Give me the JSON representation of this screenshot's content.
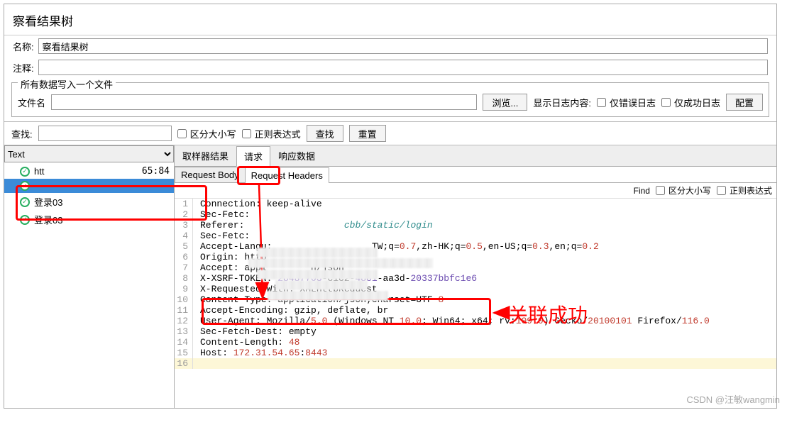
{
  "title": "察看结果树",
  "labels": {
    "name": "名称:",
    "comment": "注释:",
    "writeAll": "所有数据写入一个文件",
    "filename": "文件名",
    "browse": "浏览...",
    "showLog": "显示日志内容:",
    "errorOnly": "仅错误日志",
    "successOnly": "仅成功日志",
    "configure": "配置",
    "search": "查找:",
    "caseSensitive": "区分大小写",
    "regex": "正则表达式",
    "searchBtn": "查找",
    "reset": "重置",
    "findShort": "Find"
  },
  "values": {
    "name": "察看结果树",
    "renderer": "Text"
  },
  "tree": [
    {
      "label": "htt",
      "extra": "65:84"
    },
    {
      "label": "",
      "selected": true
    },
    {
      "label": "登录03"
    },
    {
      "label": "登录03"
    }
  ],
  "tabs": {
    "main": [
      "取样器结果",
      "请求",
      "响应数据"
    ],
    "mainActive": 1,
    "sub": [
      "Request Body",
      "Request Headers"
    ],
    "subActive": 1
  },
  "headers": [
    {
      "n": 1,
      "k": "Connection",
      "v": "keep-alive"
    },
    {
      "n": 2,
      "k": "Sec-Fetc",
      "v": ""
    },
    {
      "n": 3,
      "k": "Referer",
      "v": "",
      "trail": "cbb/static/login",
      "trailClass": "tok-url"
    },
    {
      "n": 4,
      "k": "Sec-Fetc",
      "v": ""
    },
    {
      "n": 5,
      "k": "Accept-Langu",
      "v": "",
      "trail": "TW;q=0.7,zh-HK;q=0.5,en-US;q=0.3,en;q=0.2"
    },
    {
      "n": 6,
      "k": "Origin",
      "v": "http"
    },
    {
      "n": 7,
      "k": "Accept",
      "v": "appl        n/json"
    },
    {
      "n": 8,
      "raw": "X-XSRF-TOKEN: <span class='tok-purple'>28487703</span>-c1c2-<span class='tok-purple'>4881</span>-aa3d-<span class='tok-purple'>20337bbfc1e6</span>"
    },
    {
      "n": 9,
      "k": "X-Requested-With",
      "v": "XMLHttpRequest"
    },
    {
      "n": 10,
      "raw": "Content-Type: application/json;charset=UTF-<span class='tok-num'>8</span>"
    },
    {
      "n": 11,
      "k": "Accept-Encoding",
      "v": "gzip, deflate, br"
    },
    {
      "n": 12,
      "raw": "User-Agent: Mozilla/<span class='tok-num'>5.0</span> (Windows NT <span class='tok-num'>10.0</span>; Win64; x64; rv:<span class='tok-num'>109.0</span>) Gecko/<span class='tok-num'>20100101</span> Firefox/<span class='tok-num'>116.0</span>"
    },
    {
      "n": 13,
      "k": "Sec-Fetch-Dest",
      "v": "empty"
    },
    {
      "n": 14,
      "raw": "Content-Length: <span class='tok-num'>48</span>"
    },
    {
      "n": 15,
      "raw": "Host: <span class='tok-num'>172.31.54.65</span>:<span class='tok-num'>8443</span>"
    },
    {
      "n": 16,
      "raw": "",
      "hl": true
    }
  ],
  "annotation": {
    "successText": "关联成功"
  },
  "watermark": "CSDN @汪敏wangmin"
}
